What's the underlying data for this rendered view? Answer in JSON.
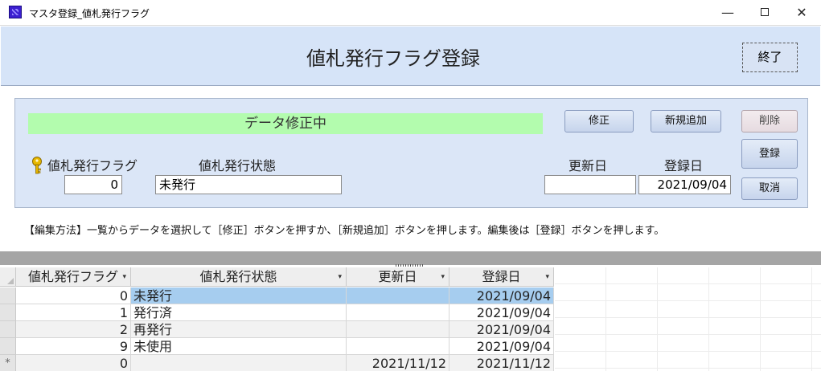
{
  "window": {
    "title": "マスタ登録_値札発行フラグ",
    "minimize": "—",
    "close": "✕"
  },
  "header": {
    "title": "値札発行フラグ登録",
    "exit_label": "終了"
  },
  "detail": {
    "status_banner": "データ修正中",
    "buttons": {
      "edit": "修正",
      "new": "新規追加",
      "delete": "削除",
      "register": "登録",
      "cancel": "取消"
    },
    "labels": {
      "flag": "値札発行フラグ",
      "status": "値札発行状態",
      "updated": "更新日",
      "created": "登録日"
    },
    "values": {
      "flag": "0",
      "status": "未発行",
      "updated": "",
      "created": "2021/09/04"
    },
    "key_icon": "key-icon",
    "colors": {
      "banner": "#b3fcae",
      "header_bg": "#d6e4f8",
      "selected_row": "#a6cdef"
    }
  },
  "instructions": "【編集方法】一覧からデータを選択して［修正］ボタンを押すか、［新規追加］ボタンを押します。編集後は［登録］ボタンを押します。",
  "grid": {
    "columns": [
      "値札発行フラグ",
      "値札発行状態",
      "更新日",
      "登録日"
    ],
    "dropdown_glyph": "▾",
    "rows": [
      {
        "flag": "0",
        "status": "未発行",
        "updated": "",
        "created": "2021/09/04"
      },
      {
        "flag": "1",
        "status": "発行済",
        "updated": "",
        "created": "2021/09/04"
      },
      {
        "flag": "2",
        "status": "再発行",
        "updated": "",
        "created": "2021/09/04"
      },
      {
        "flag": "9",
        "status": "未使用",
        "updated": "",
        "created": "2021/09/04"
      }
    ],
    "new_row": {
      "marker": "*",
      "flag": "0",
      "status": "",
      "updated": "2021/11/12",
      "created": "2021/11/12"
    }
  }
}
